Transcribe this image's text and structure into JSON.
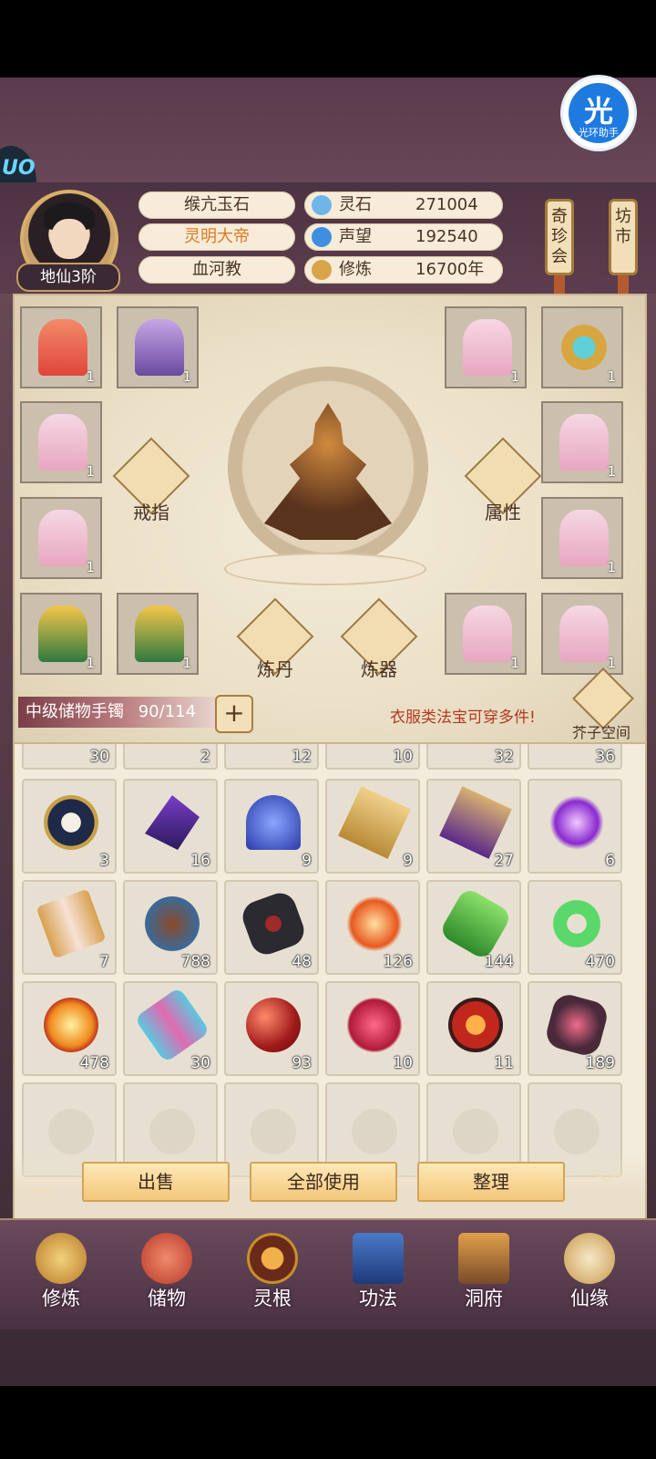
{
  "header": {
    "avatar_rank": "地仙3阶",
    "identity": [
      "缑亢玉石",
      "灵明大帝",
      "血河教"
    ],
    "resources": [
      {
        "icon": "spirit-stone-icon",
        "label": "灵石",
        "value": "271004"
      },
      {
        "icon": "reputation-icon",
        "label": "声望",
        "value": "192540"
      },
      {
        "icon": "cultivation-icon",
        "label": "修炼",
        "value": "16700年"
      }
    ],
    "scroll_buttons": [
      "奇珍会",
      "坊市"
    ],
    "helper_badge": {
      "glyph": "光",
      "label": "光环助手"
    },
    "side_logo": "UO"
  },
  "equipment": {
    "slots": [
      {
        "icon": "red-robe-icon",
        "count": "1"
      },
      {
        "icon": "horse-mount-icon",
        "count": "1"
      },
      {
        "icon": "pink-robe-icon",
        "count": "1"
      },
      {
        "icon": "golden-ring-icon",
        "count": "1"
      },
      {
        "icon": "pink-robe-icon",
        "count": "1"
      },
      {
        "icon": "pink-robe-icon",
        "count": "1"
      },
      {
        "icon": "pink-robe-icon",
        "count": "1"
      },
      {
        "icon": "pink-robe-icon",
        "count": "1"
      },
      {
        "icon": "green-robe-icon",
        "count": "1"
      },
      {
        "icon": "green-robe-icon",
        "count": "1"
      },
      {
        "icon": "pink-robe-icon",
        "count": "1"
      },
      {
        "icon": "pink-robe-icon",
        "count": "1"
      }
    ],
    "diamond_buttons": [
      "戒指",
      "属性",
      "炼丹",
      "炼器"
    ]
  },
  "bag": {
    "name": "中级储物手镯",
    "capacity": "90/114",
    "plus": "+",
    "tip": "衣服类法宝可穿多件!",
    "mustard_space": "芥子空间"
  },
  "inventory": {
    "partial_row": [
      "30",
      "2",
      "12",
      "10",
      "32",
      "36"
    ],
    "rows": [
      [
        {
          "icon": "yin-yang-compass-icon",
          "count": "3"
        },
        {
          "icon": "purple-crystal-icon",
          "count": "16"
        },
        {
          "icon": "blue-spirit-herb-icon",
          "count": "9"
        },
        {
          "icon": "golden-talisman-icon",
          "count": "9"
        },
        {
          "icon": "purple-talisman-icon",
          "count": "27"
        },
        {
          "icon": "purple-flame-icon",
          "count": "6"
        }
      ],
      [
        {
          "icon": "scroll-icon",
          "count": "7"
        },
        {
          "icon": "dragon-root-icon",
          "count": "788"
        },
        {
          "icon": "dark-stone-icon",
          "count": "48"
        },
        {
          "icon": "fire-crystal-icon",
          "count": "126"
        },
        {
          "icon": "jade-scroll-icon",
          "count": "144"
        },
        {
          "icon": "jade-ring-icon",
          "count": "470"
        }
      ],
      [
        {
          "icon": "fire-orb-icon",
          "count": "478"
        },
        {
          "icon": "colorful-scroll-icon",
          "count": "30"
        },
        {
          "icon": "red-pearl-icon",
          "count": "93"
        },
        {
          "icon": "red-lotus-icon",
          "count": "10"
        },
        {
          "icon": "swirl-cauldron-icon",
          "count": "11"
        },
        {
          "icon": "demon-shard-icon",
          "count": "189"
        }
      ]
    ],
    "empty_slots": 6
  },
  "actions": {
    "sell": "出售",
    "use_all": "全部使用",
    "sort": "整理"
  },
  "nav": [
    {
      "icon": "cultivation-nav-icon",
      "label": "修炼"
    },
    {
      "icon": "storage-bag-icon",
      "label": "储物"
    },
    {
      "icon": "spirit-root-icon",
      "label": "灵根"
    },
    {
      "icon": "technique-book-icon",
      "label": "功法"
    },
    {
      "icon": "cave-house-icon",
      "label": "洞府"
    },
    {
      "icon": "fate-gourd-icon",
      "label": "仙缘"
    }
  ],
  "colors": {
    "accent_orange": "#e07a1e",
    "tip_red": "#b23a1f",
    "panel_cream": "#f3ebdc",
    "frame_purple": "#5c3d4e",
    "helper_blue": "#1f7ae0"
  }
}
